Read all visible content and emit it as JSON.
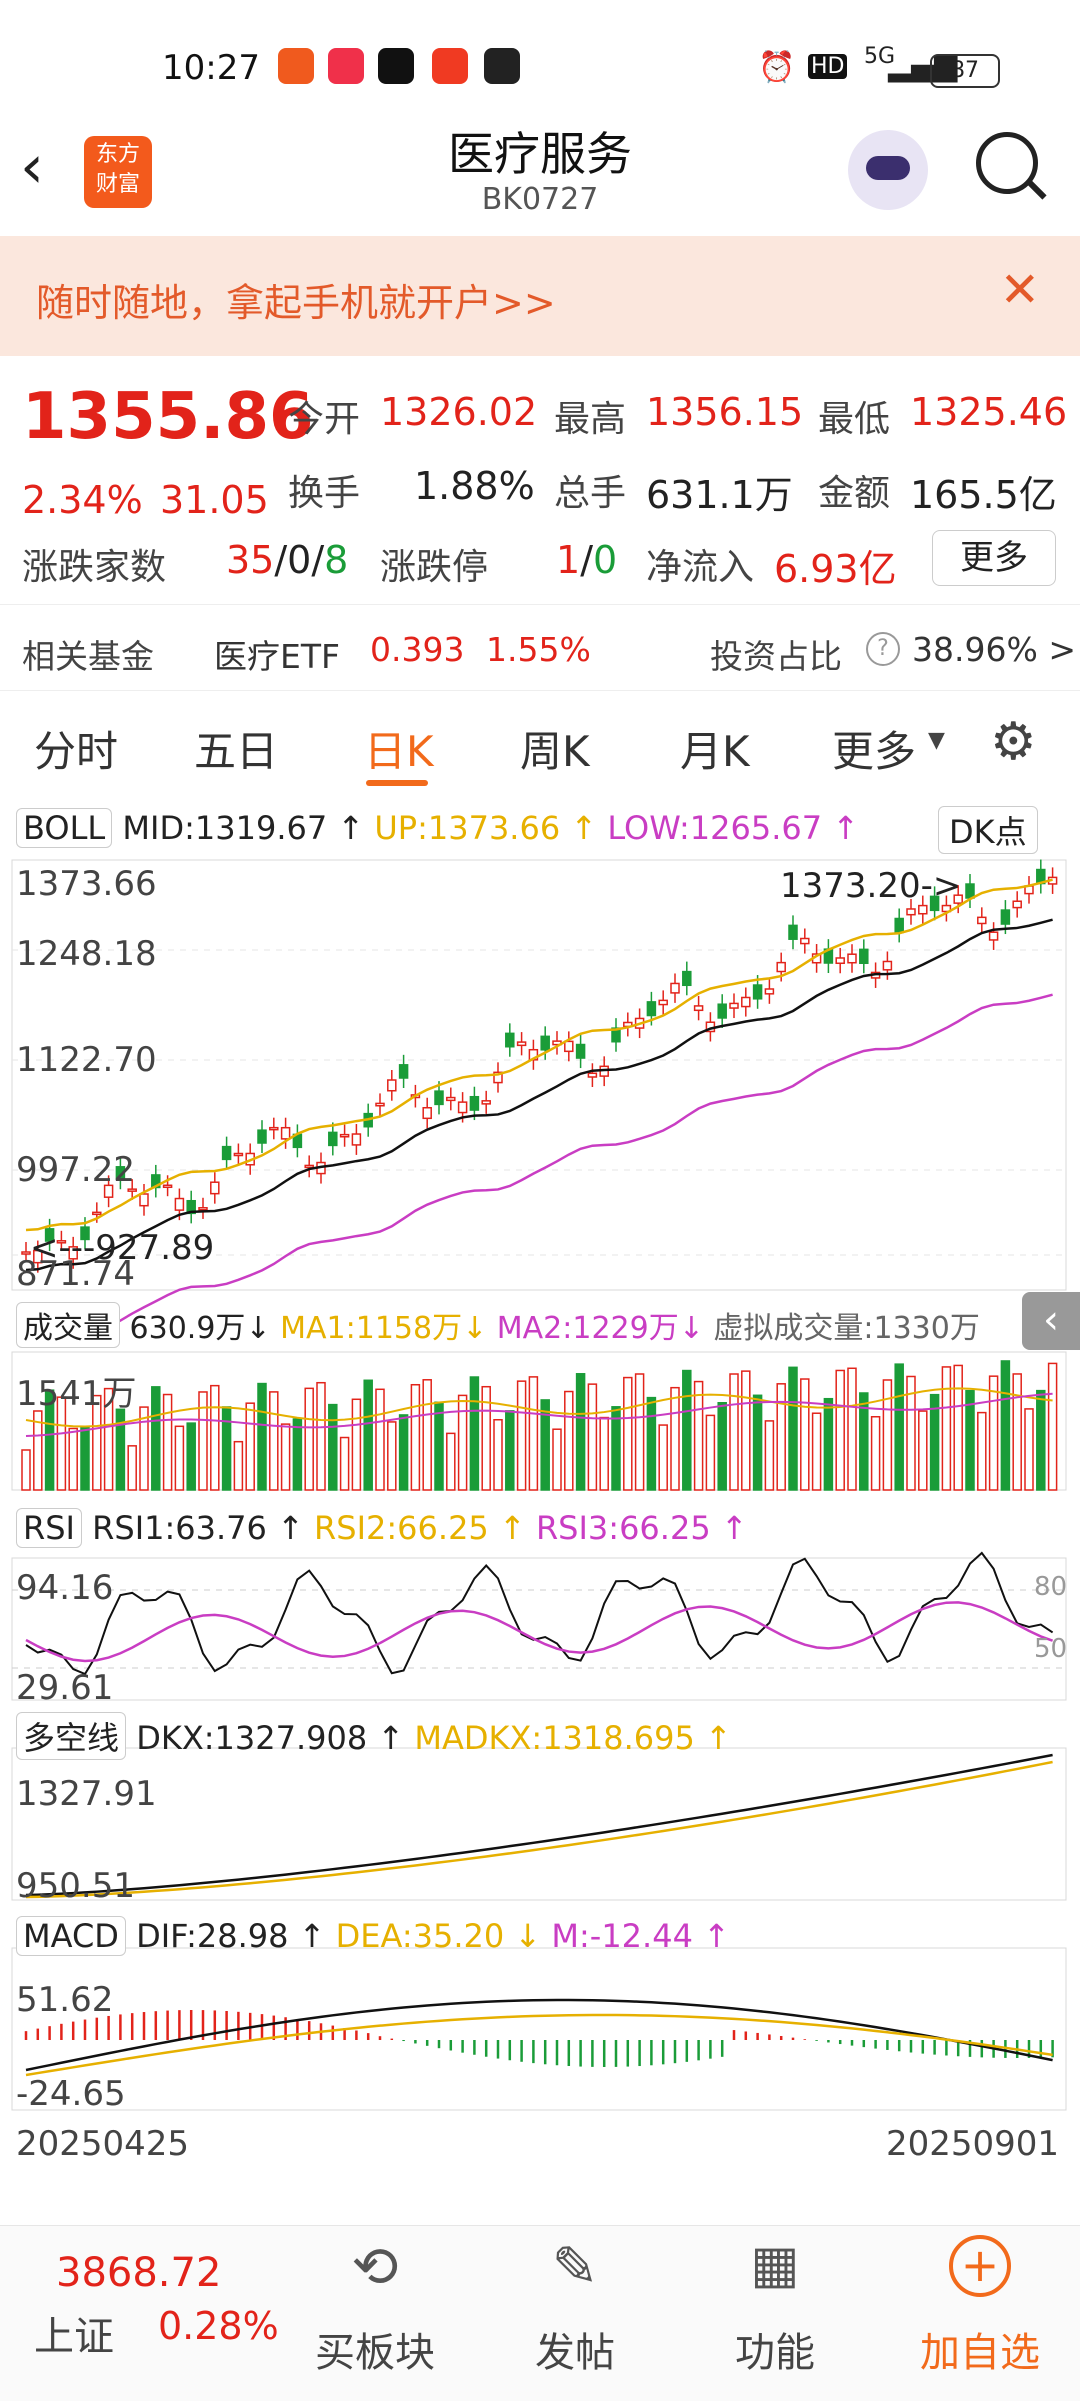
{
  "status_bar": {
    "time": "10:27",
    "battery": "87",
    "network": "5G",
    "hd": "HD"
  },
  "header": {
    "title": "医疗服务",
    "code": "BK0727",
    "logo_line1": "东方",
    "logo_line2": "财富"
  },
  "banner": {
    "text": "随时随地，拿起手机就开户>>"
  },
  "quote": {
    "price": "1355.86",
    "change_pct": "2.34%",
    "change": "31.05",
    "open_label": "今开",
    "open": "1326.02",
    "high_label": "最高",
    "high": "1356.15",
    "low_label": "最低",
    "low": "1325.46",
    "turnover_label": "换手",
    "turnover": "1.88%",
    "volume_label": "总手",
    "volume": "631.1万",
    "amount_label": "金额",
    "amount": "165.5亿",
    "updown_label": "涨跌家数",
    "up": "35",
    "flat": "0",
    "down": "8",
    "limit_label": "涨跌停",
    "limit_up": "1",
    "limit_down": "0",
    "inflow_label": "净流入",
    "inflow": "6.93亿",
    "more": "更多",
    "fund_label": "相关基金",
    "fund_name": "医疗ETF",
    "fund_price": "0.393",
    "fund_pct": "1.55%",
    "invest_label": "投资占比",
    "invest_value": "38.96% >"
  },
  "tabs": [
    "分时",
    "五日",
    "日K",
    "周K",
    "月K",
    "更多"
  ],
  "active_tab": "日K",
  "kline": {
    "indicator": "BOLL",
    "mid": "MID:1319.67",
    "up": "UP:1373.66",
    "low": "LOW:1265.67",
    "dk": "DK点",
    "y_labels": [
      "1373.66",
      "1248.18",
      "1122.70",
      "997.22",
      "871.74"
    ],
    "max_marker": "1373.20->",
    "min_marker": "<---927.89"
  },
  "volume": {
    "indicator": "成交量",
    "value": "630.9万",
    "ma1": "MA1:1158万",
    "ma2": "MA2:1229万",
    "virtual": "虚拟成交量:1330万",
    "y_label": "1541万"
  },
  "rsi": {
    "indicator": "RSI",
    "rsi1": "RSI1:63.76",
    "rsi2": "RSI2:66.25",
    "rsi3": "RSI3:66.25",
    "y_top": "94.16",
    "y_bottom": "29.61",
    "level80": "80",
    "level50": "50"
  },
  "dkx": {
    "indicator": "多空线",
    "dkx": "DKX:1327.908",
    "madkx": "MADKX:1318.695",
    "y_top": "1327.91",
    "y_bottom": "950.51"
  },
  "macd": {
    "indicator": "MACD",
    "dif": "DIF:28.98",
    "dea": "DEA:35.20",
    "m": "M:-12.44",
    "y_top": "51.62",
    "y_bottom": "-24.65"
  },
  "dates": {
    "start": "20250425",
    "end": "20250901"
  },
  "bottom": {
    "index_price": "3868.72",
    "index_name": "上证",
    "index_pct": "0.28%",
    "buttons": [
      "买板块",
      "发帖",
      "功能",
      "加自选"
    ]
  },
  "colors": {
    "red": "#e2231a",
    "green": "#1a9c38",
    "orange": "#f08a24",
    "accent": "#ff6a00"
  }
}
